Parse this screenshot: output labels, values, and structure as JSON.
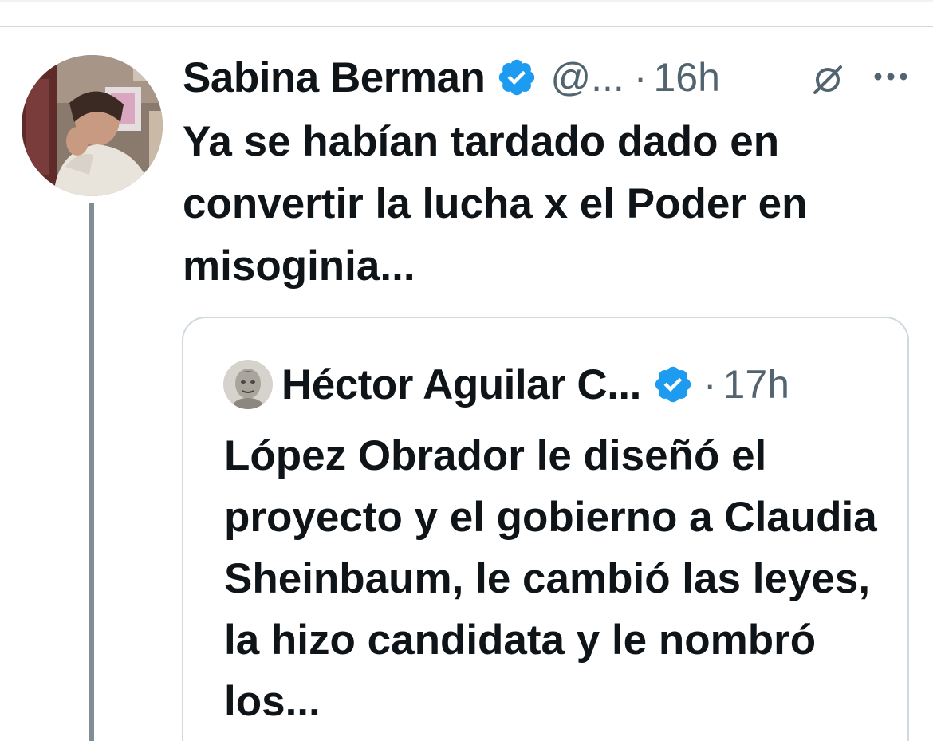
{
  "tweet": {
    "author_name": "Sabina Berman",
    "handle": "@...",
    "separator": "·",
    "time": "16h",
    "text": "Ya se habían tardado dado en convertir la lucha x el Poder en misoginia...",
    "avatar_icon": "user-avatar-photo",
    "verified_icon": "verified-badge-icon",
    "grok_icon": "grok-icon",
    "more_icon": "more-options-icon"
  },
  "quote": {
    "author_name": "Héctor Aguilar C...",
    "separator": "·",
    "time": "17h",
    "text": "López Obrador le diseñó el proyecto y el gobierno a Claudia Sheinbaum, le cambió las leyes, la hizo candidata y le nombró los...",
    "avatar_icon": "user-avatar-photo",
    "verified_icon": "verified-badge-icon"
  },
  "colors": {
    "text_primary": "#0f1419",
    "text_secondary": "#536471",
    "verified_blue": "#1d9bf0",
    "border": "#cfd9de",
    "thread_line": "#828d95"
  }
}
